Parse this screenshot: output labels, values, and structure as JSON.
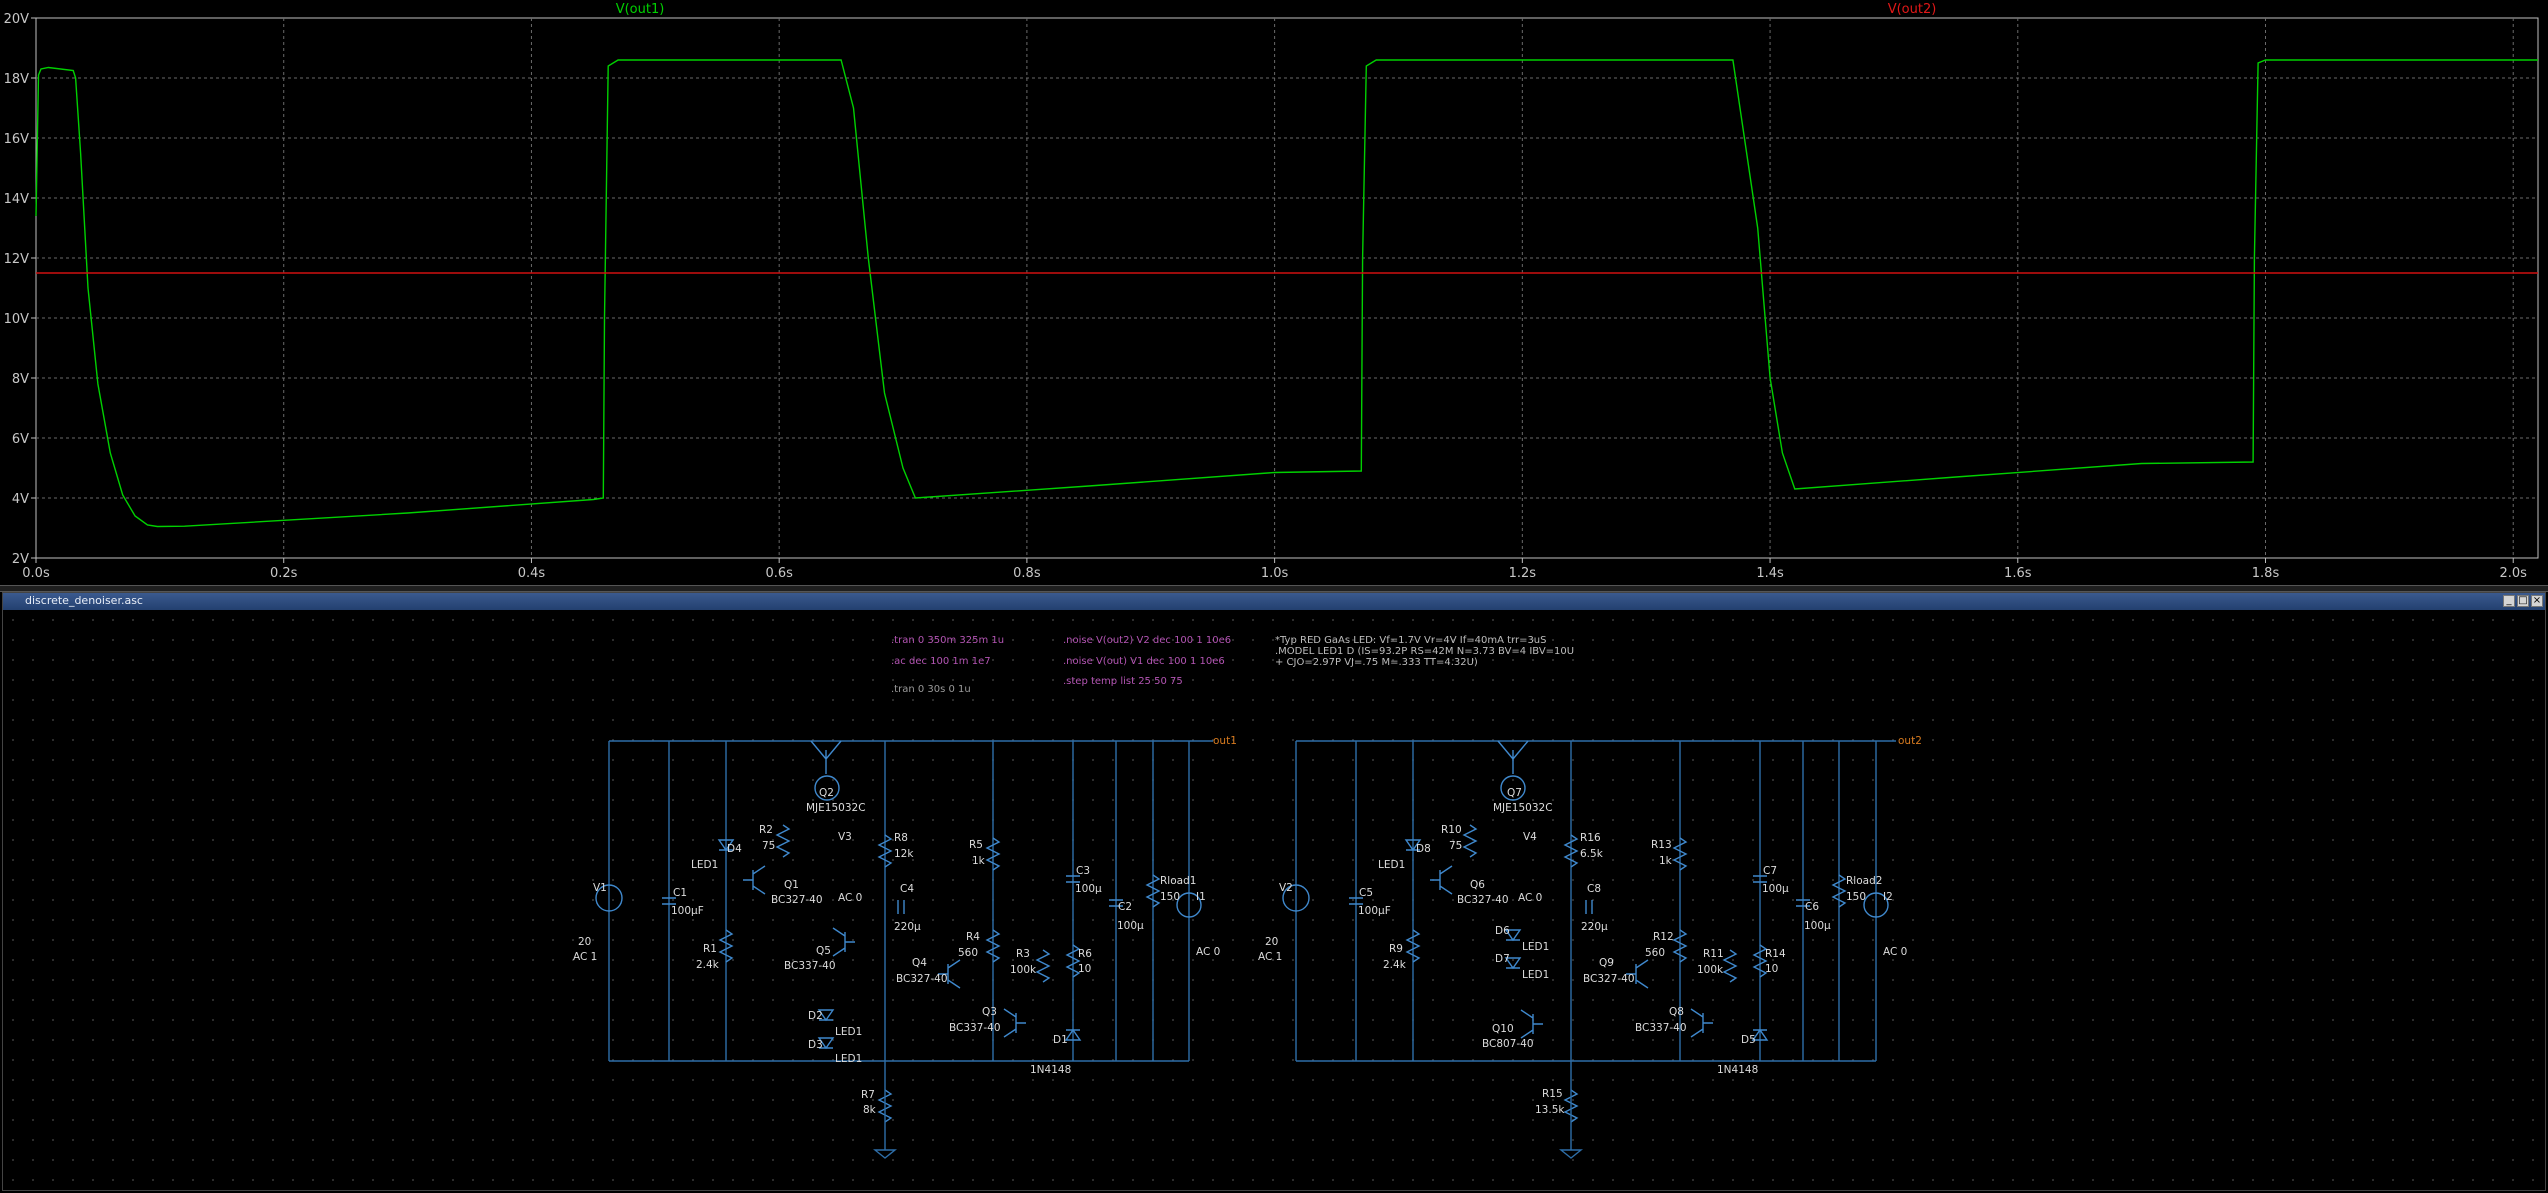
{
  "plot": {
    "traces": [
      {
        "name": "V(out1)",
        "color": "#00d000"
      },
      {
        "name": "V(out2)",
        "color": "#d01010"
      }
    ],
    "grid_color": "#6a6a6a",
    "axis_color": "#bfbfbf"
  },
  "chart_data": {
    "type": "line",
    "xlim": [
      0,
      2.02
    ],
    "ylim": [
      2,
      20
    ],
    "x_ticks": [
      "0.0s",
      "0.2s",
      "0.4s",
      "0.6s",
      "0.8s",
      "1.0s",
      "1.2s",
      "1.4s",
      "1.6s",
      "1.8s",
      "2.0s"
    ],
    "y_ticks": [
      "2V",
      "4V",
      "6V",
      "8V",
      "10V",
      "12V",
      "14V",
      "16V",
      "18V",
      "20V"
    ],
    "grid": true,
    "series": [
      {
        "name": "V(out1)",
        "color": "#00d000",
        "x": [
          0.0,
          0.002,
          0.004,
          0.01,
          0.03,
          0.032,
          0.036,
          0.042,
          0.05,
          0.06,
          0.07,
          0.08,
          0.09,
          0.098,
          0.12,
          0.3,
          0.45,
          0.458,
          0.459,
          0.462,
          0.47,
          0.55,
          0.65,
          0.66,
          0.672,
          0.685,
          0.7,
          0.71,
          0.85,
          1.0,
          1.07,
          1.071,
          1.074,
          1.082,
          1.1,
          1.2,
          1.3,
          1.37,
          1.39,
          1.4,
          1.41,
          1.42,
          1.55,
          1.7,
          1.79,
          1.791,
          1.794,
          1.8,
          2.02
        ],
        "y": [
          13.4,
          18.1,
          18.3,
          18.35,
          18.25,
          18.0,
          15.5,
          11.0,
          7.8,
          5.5,
          4.1,
          3.4,
          3.1,
          3.05,
          3.06,
          3.5,
          3.95,
          4.0,
          10.0,
          18.4,
          18.6,
          18.6,
          18.6,
          17.0,
          12.0,
          7.5,
          5.0,
          4.0,
          4.4,
          4.85,
          4.9,
          12.0,
          18.4,
          18.6,
          18.6,
          18.6,
          18.6,
          18.6,
          13.0,
          8.0,
          5.5,
          4.3,
          4.7,
          5.15,
          5.2,
          12.0,
          18.5,
          18.6,
          18.6
        ]
      },
      {
        "name": "V(out2)",
        "color": "#d01010",
        "x": [
          0.0,
          2.02
        ],
        "y": [
          11.5,
          11.5
        ]
      }
    ]
  },
  "schematic": {
    "window_title": "discrete_denoiser.asc",
    "directives": {
      "tran1": ".tran 0 350m 325m 1u",
      "ac": ".ac dec 100 1m 1e7",
      "tran2": ".tran 0 30s 0 1u",
      "noise1": ".noise V(out2) V2 dec 100 1 10e6",
      "noise2": ".noise V(out) V1 dec 100 1 10e6",
      "step": ".step temp list 25 50 75",
      "comment1": "*Typ RED GaAs LED: Vf=1.7V Vr=4V If=40mA trr=3uS",
      "comment2": ".MODEL LED1 D (IS=93.2P RS=42M N=3.73 BV=4 IBV=10U",
      "comment3": "+ CJO=2.97P VJ=.75 M=.333 TT=4.32U)"
    },
    "nets": {
      "out1": "out1",
      "out2": "out2"
    },
    "labels": {
      "V1": "V1",
      "V1_val": "20",
      "V1_ac": "AC 1",
      "C1": "C1",
      "C1_val": "100µF",
      "D4": "D4",
      "LED1_a": "LED1",
      "R2": "R2",
      "R2_val": "75",
      "Q2": "Q2",
      "Q2_model": "MJE15032C",
      "V3": "V3",
      "V3_ac": "AC 0",
      "Q1": "Q1",
      "Q1_model": "BC327-40",
      "R1": "R1",
      "R1_val": "2.4k",
      "Q5": "Q5",
      "Q5_model": "BC337-40",
      "D2": "D2",
      "D2_model": "LED1",
      "D3": "D3",
      "D3_model": "LED1",
      "R7": "R7",
      "R7_val": "8k",
      "R8": "R8",
      "R8_val": "12k",
      "C4": "C4",
      "C4_val": "220µ",
      "R5": "R5",
      "R5_val": "1k",
      "R4": "R4",
      "R4_val": "560",
      "Q4": "Q4",
      "Q4_model": "BC327-40",
      "R3": "R3",
      "R3_val": "100k",
      "Q3": "Q3",
      "Q3_model": "BC337-40",
      "D1": "D1",
      "D1_model": "1N4148",
      "C3": "C3",
      "C3_val": "100µ",
      "R6": "R6",
      "R6_val": "10",
      "C2": "C2",
      "C2_val": "100µ",
      "Rload1": "Rload1",
      "Rload1_val": "150",
      "I1": "I1",
      "I1_ac": "AC 0",
      "V2": "V2",
      "V2_val": "20",
      "V2_ac": "AC 1",
      "C5": "C5",
      "C5_val": "100µF",
      "D8": "D8",
      "LED1_b": "LED1",
      "R10": "R10",
      "R10_val": "75",
      "Q7": "Q7",
      "Q7_model": "MJE15032C",
      "V4": "V4",
      "V4_ac": "AC 0",
      "Q6": "Q6",
      "Q6_model": "BC327-40",
      "R9": "R9",
      "R9_val": "2.4k",
      "D6": "D6",
      "D6_model": "LED1",
      "D7": "D7",
      "D7_model": "LED1",
      "Q10": "Q10",
      "Q10_model": "BC807-40",
      "R15": "R15",
      "R15_val": "13.5k",
      "R16": "R16",
      "R16_val": "6.5k",
      "C8": "C8",
      "C8_val": "220µ",
      "R13": "R13",
      "R13_val": "1k",
      "R12": "R12",
      "R12_val": "560",
      "Q9": "Q9",
      "Q9_model": "BC327-40",
      "R11": "R11",
      "R11_val": "100k",
      "Q8": "Q8",
      "Q8_model": "BC337-40",
      "D5": "D5",
      "D5_model": "1N4148",
      "C7": "C7",
      "C7_val": "100µ",
      "R14": "R14",
      "R14_val": "10",
      "C6": "C6",
      "C6_val": "100µ",
      "Rload2": "Rload2",
      "Rload2_val": "150",
      "I2": "I2",
      "I2_ac": "AC 0"
    }
  }
}
